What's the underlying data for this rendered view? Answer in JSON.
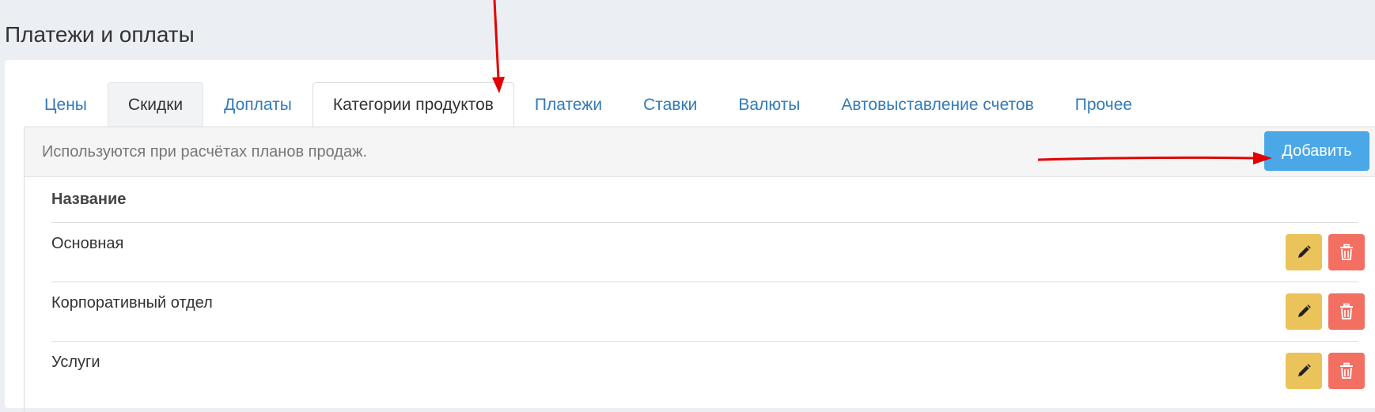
{
  "page": {
    "title": "Платежи и оплаты"
  },
  "tabs": [
    {
      "label": "Цены",
      "state": "normal"
    },
    {
      "label": "Скидки",
      "state": "greyed"
    },
    {
      "label": "Доплаты",
      "state": "normal"
    },
    {
      "label": "Категории продуктов",
      "state": "active"
    },
    {
      "label": "Платежи",
      "state": "normal"
    },
    {
      "label": "Ставки",
      "state": "normal"
    },
    {
      "label": "Валюты",
      "state": "normal"
    },
    {
      "label": "Автовыставление счетов",
      "state": "normal"
    },
    {
      "label": "Прочее",
      "state": "normal"
    }
  ],
  "info_bar": {
    "text": "Используются при расчётах планов продаж.",
    "add_label": "Добавить"
  },
  "table": {
    "header": "Название",
    "rows": [
      {
        "name": "Основная"
      },
      {
        "name": "Корпоративный отдел"
      },
      {
        "name": "Услуги"
      }
    ]
  },
  "icons": {
    "edit": "pencil-icon",
    "delete": "trash-icon"
  },
  "colors": {
    "link": "#337ab7",
    "add_button": "#4aa8e6",
    "edit_button": "#eac35b",
    "delete_button": "#f26f62",
    "annotation_arrow": "#e30000"
  }
}
